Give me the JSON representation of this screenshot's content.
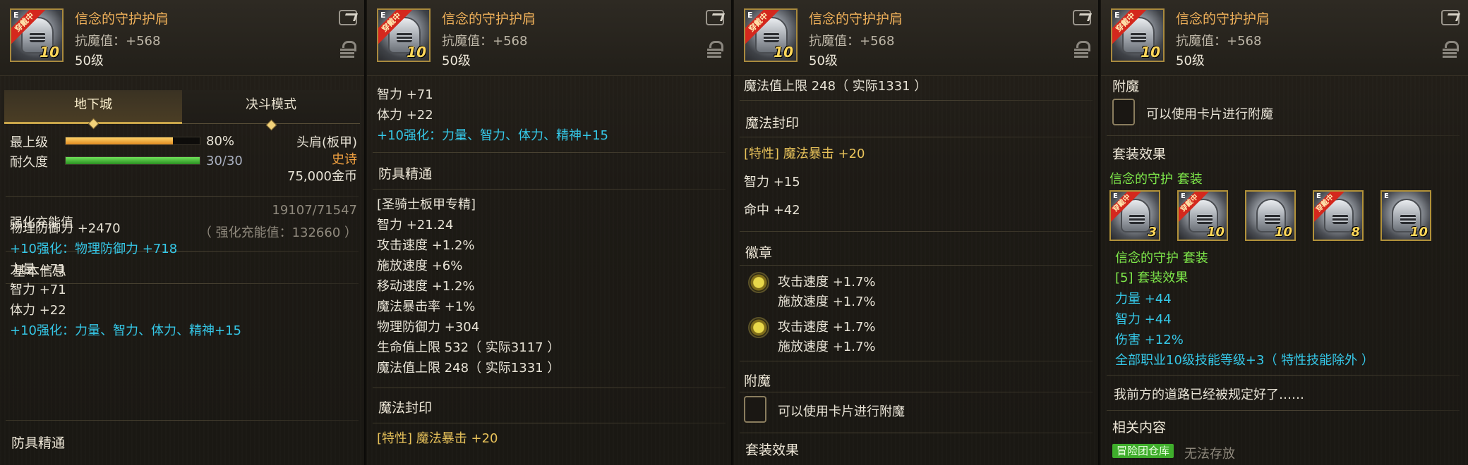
{
  "item": {
    "name": "信念的守护护肩",
    "resist": "抗魔值：+568",
    "level": "50级",
    "icon_ribbon": "穿戴中",
    "icon_grade": "E",
    "icon_plus": "10"
  },
  "panel1": {
    "tab_dungeon": "地下城",
    "tab_duel": "决斗模式",
    "max_level_label": "最上级",
    "max_level_pct": 80,
    "max_level_value": "80%",
    "durability_label": "耐久度",
    "durability_fraction": 1.0,
    "durability_value": "30/30",
    "slot": "头肩(板甲)",
    "rarity": "史诗",
    "price": "75,000金币",
    "charge_label": "强化充能值",
    "charge_value": "19107/71547",
    "charge_total": "（ 强化充能值：132660 ）",
    "basic_title": "基本信息",
    "lines": [
      {
        "text": "物理防御力 +2470",
        "color": "white"
      },
      {
        "text": "+10强化：物理防御力 +718",
        "color": "cyan"
      },
      {
        "text": "力量 +71",
        "color": "white"
      },
      {
        "text": "智力 +71",
        "color": "white"
      },
      {
        "text": "体力 +22",
        "color": "white"
      },
      {
        "text": "+10强化：力量、智力、体力、精神+15",
        "color": "cyan"
      }
    ],
    "mastery_title": "防具精通"
  },
  "panel2": {
    "top_lines": [
      {
        "text": "智力 +71",
        "color": "white"
      },
      {
        "text": "体力 +22",
        "color": "white"
      },
      {
        "text": "+10强化：力量、智力、体力、精神+15",
        "color": "cyan"
      }
    ],
    "mastery_title": "防具精通",
    "mastery_lines": [
      "[圣骑士板甲专精]",
      "智力 +21.24",
      "攻击速度 +1.2%",
      "施放速度 +6%",
      "移动速度 +1.2%",
      "魔法暴击率 +1%",
      "物理防御力 +304",
      "生命值上限 532（ 实际3117 ）",
      "魔法值上限 248（ 实际1331 ）"
    ],
    "seal_title": "魔法封印",
    "seal_line": "[特性] 魔法暴击 +20"
  },
  "panel3": {
    "top_line": "魔法值上限 248（ 实际1331 ）",
    "seal_title": "魔法封印",
    "seal_lines": [
      {
        "text": "[特性] 魔法暴击 +20",
        "color": "yellow"
      },
      {
        "text": "智力 +15",
        "color": "white"
      },
      {
        "text": "命中 +42",
        "color": "white"
      }
    ],
    "emblem_title": "徽章",
    "emblems": [
      {
        "line1": "攻击速度 +1.7%",
        "line2": "施放速度 +1.7%"
      },
      {
        "line1": "攻击速度 +1.7%",
        "line2": "施放速度 +1.7%"
      }
    ],
    "enchant_title": "附魔",
    "enchant_text": "可以使用卡片进行附魔",
    "set_title": "套装效果"
  },
  "panel4": {
    "enchant_title": "附魔",
    "enchant_text": "可以使用卡片进行附魔",
    "set_title": "套装效果",
    "set_name": "信念的守护 套装",
    "set_icons": [
      {
        "grade": "E",
        "ribbon": "穿戴中",
        "plus": "3"
      },
      {
        "grade": "E",
        "ribbon": "穿戴中",
        "plus": "10"
      },
      {
        "grade": "",
        "ribbon": "",
        "plus": "10"
      },
      {
        "grade": "E",
        "ribbon": "穿戴中",
        "plus": "8"
      },
      {
        "grade": "E",
        "ribbon": "",
        "plus": "10"
      }
    ],
    "set_name2": "信念的守护 套装",
    "set_effect_title": "[5] 套装效果",
    "set_effects": [
      "力量 +44",
      "智力 +44",
      "伤害 +12%",
      "全部职业10级技能等级+3（ 特性技能除外 ）"
    ],
    "flavor": "我前方的道路已经被规定好了……",
    "related_title": "相关内容",
    "related_badge": "冒险团仓库",
    "related_text": "无法存放"
  },
  "colors": {
    "name": "#f0b15a",
    "cyan": "#35c8e8",
    "green": "#7ee84a",
    "rarity": "#f0a040",
    "bar_orange": "#f0a73a",
    "bar_green": "#3fb22f"
  }
}
